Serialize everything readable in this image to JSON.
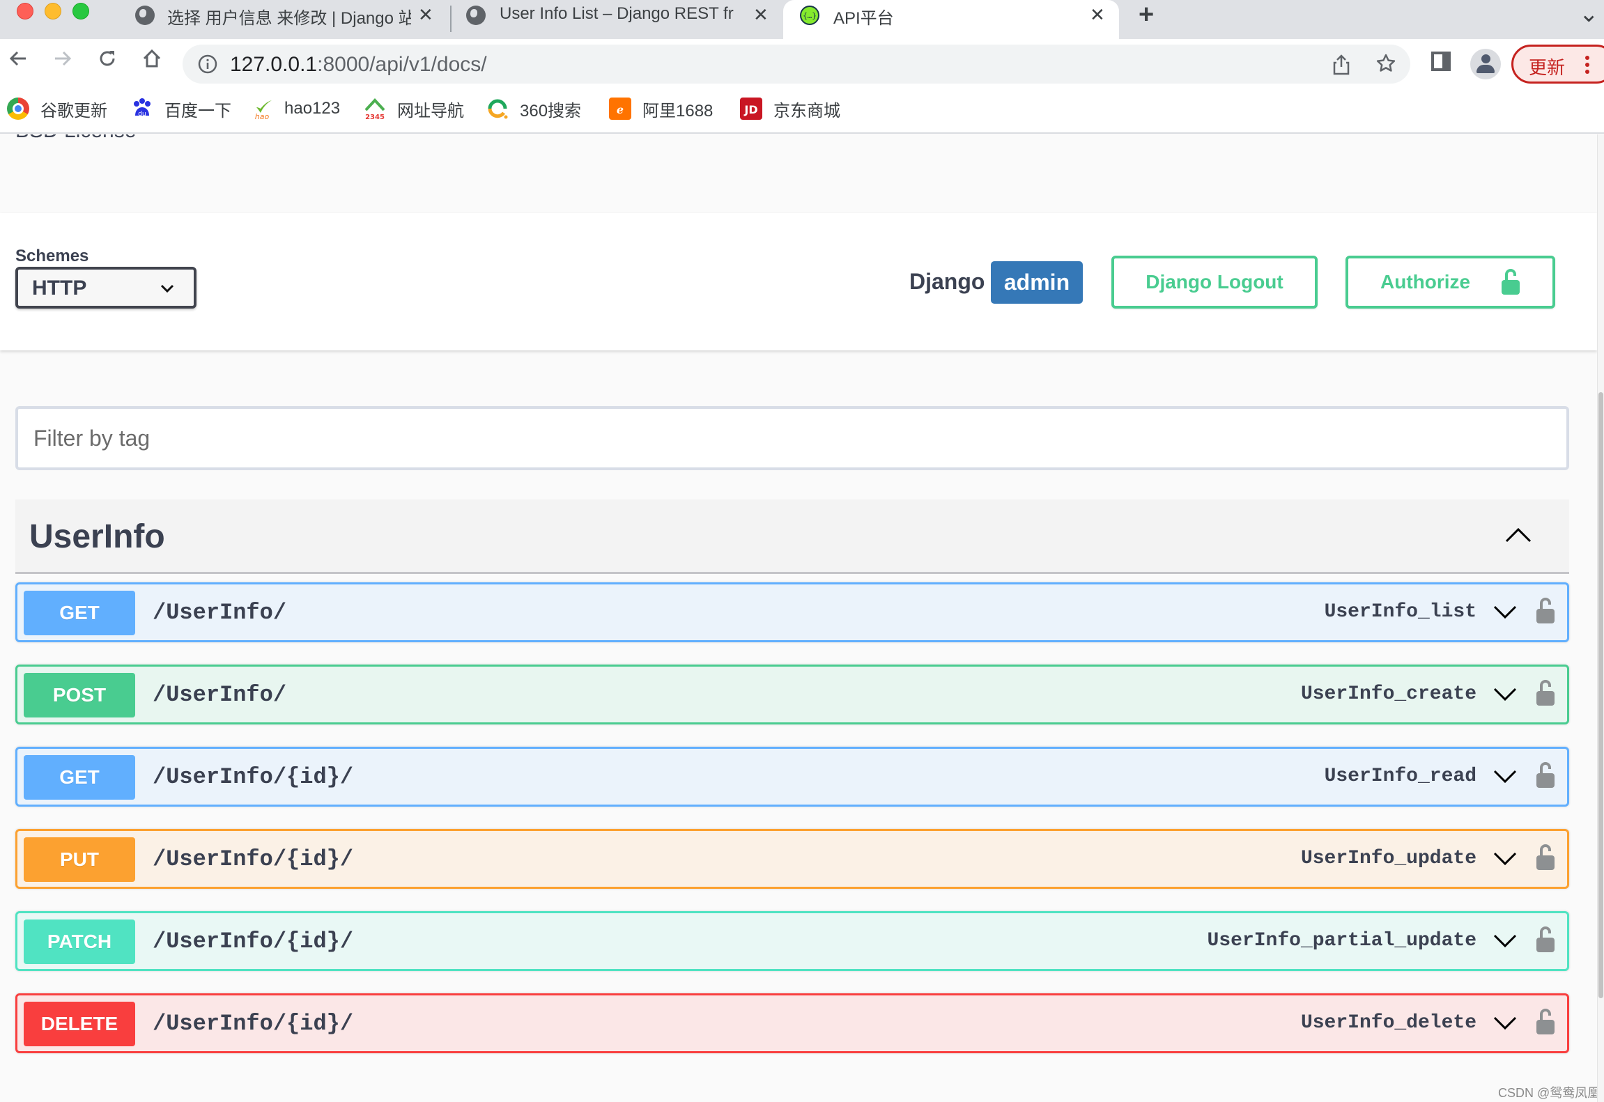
{
  "browser": {
    "tabs": [
      {
        "title": "选择 用户信息 来修改 | Django 站",
        "icon": "globe-icon",
        "active": false
      },
      {
        "title": "User Info List – Django REST fr",
        "icon": "globe-icon",
        "active": false
      },
      {
        "title": "API平台",
        "icon": "swagger-icon",
        "active": true
      }
    ],
    "close_glyph": "✕",
    "new_tab_glyph": "+",
    "tab_list_glyph": "⌄",
    "url_host": "127.0.0.1",
    "url_path": ":8000/api/v1/docs/",
    "update_label": "更新",
    "bookmarks": [
      {
        "label": "谷歌更新",
        "icon": "chrome-icon"
      },
      {
        "label": "百度一下",
        "icon": "baidu-icon"
      },
      {
        "label": "hao123",
        "icon": "hao123-icon"
      },
      {
        "label": "网址导航",
        "icon": "2345-icon"
      },
      {
        "label": "360搜索",
        "icon": "360-search-icon"
      },
      {
        "label": "阿里1688",
        "icon": "alibaba-1688-icon"
      },
      {
        "label": "京东商城",
        "icon": "jd-icon"
      }
    ]
  },
  "swagger": {
    "license_text": "BSD License",
    "schemes_label": "Schemes",
    "scheme_selected": "HTTP",
    "django_label": "Django",
    "user_badge": "admin",
    "logout_label": "Django Logout",
    "authorize_label": "Authorize",
    "filter_placeholder": "Filter by tag",
    "filter_value": "",
    "tag": {
      "name": "UserInfo",
      "expanded": true,
      "operations": [
        {
          "method": "GET",
          "path": "/UserInfo/",
          "operation_id": "UserInfo_list",
          "color": "#61affe",
          "bg": "#ebf3fb"
        },
        {
          "method": "POST",
          "path": "/UserInfo/",
          "operation_id": "UserInfo_create",
          "color": "#49cc90",
          "bg": "#e8f6f0"
        },
        {
          "method": "GET",
          "path": "/UserInfo/{id}/",
          "operation_id": "UserInfo_read",
          "color": "#61affe",
          "bg": "#ebf3fb"
        },
        {
          "method": "PUT",
          "path": "/UserInfo/{id}/",
          "operation_id": "UserInfo_update",
          "color": "#fca130",
          "bg": "#fbf1e6"
        },
        {
          "method": "PATCH",
          "path": "/UserInfo/{id}/",
          "operation_id": "UserInfo_partial_update",
          "color": "#50e3c2",
          "bg": "#e9f8f5"
        },
        {
          "method": "DELETE",
          "path": "/UserInfo/{id}/",
          "operation_id": "UserInfo_delete",
          "color": "#f93e3e",
          "bg": "#fbe7e7"
        }
      ]
    },
    "accent_green": "#49cc90",
    "user_badge_color": "#3578b7"
  },
  "watermark": "CSDN @鸳鸯凤凰"
}
